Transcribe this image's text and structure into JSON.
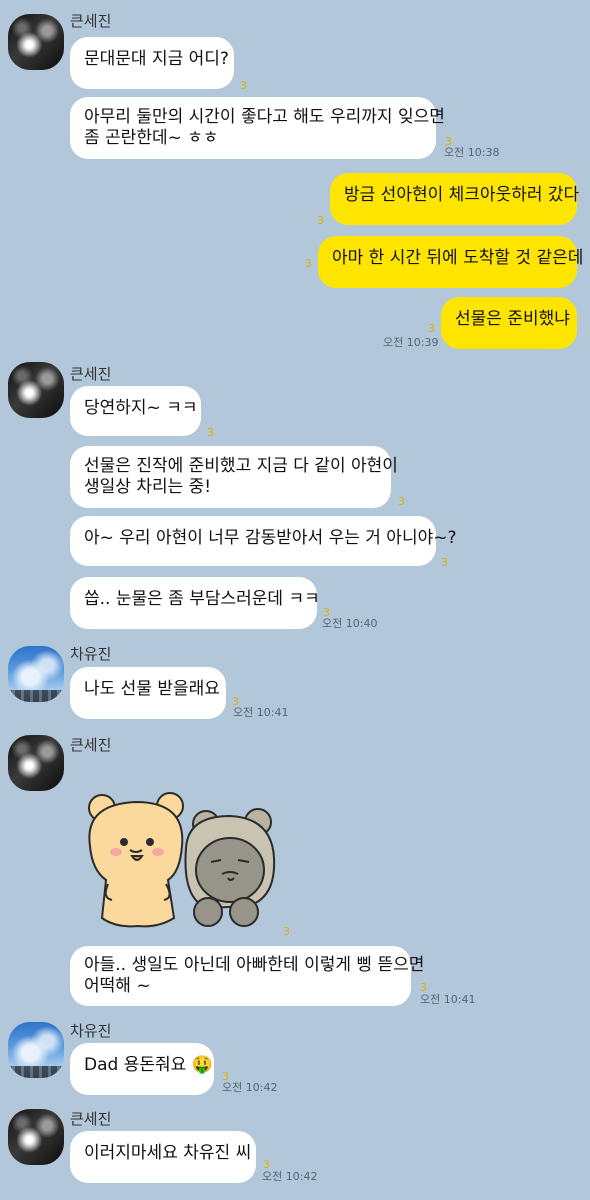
{
  "senders": {
    "seijin": "큰세진",
    "yujin": "차유진"
  },
  "messages": [
    {
      "text": "문대문대 지금 어디?",
      "unread": "3"
    },
    {
      "line1": "아무리 둘만의 시간이 좋다고 해도 우리까지 잊으면",
      "line2": "좀 곤란한데~ ㅎㅎ",
      "unread": "3",
      "time": "오전 10:38"
    },
    {
      "text": "방금 선아현이 체크아웃하러 갔다",
      "unread": "3"
    },
    {
      "text": "아마 한 시간 뒤에 도착할 것 같은데",
      "unread": "3"
    },
    {
      "text": "선물은 준비했냐",
      "unread": "3",
      "time": "오전 10:39"
    },
    {
      "text": "당연하지~ ㅋㅋ",
      "unread": "3"
    },
    {
      "line1": "선물은 진작에 준비했고 지금 다 같이 아현이",
      "line2": "생일상 차리는 중!",
      "unread": "3"
    },
    {
      "text": "아~ 우리 아현이 너무 감동받아서 우는 거 아니야~?",
      "unread": "3"
    },
    {
      "text": "씁.. 눈물은 좀 부담스러운데 ㅋㅋ",
      "unread": "3",
      "time": "오전 10:40"
    },
    {
      "text": "나도 선물 받을래요",
      "unread": "3",
      "time": "오전 10:41"
    },
    {
      "unread": "3"
    },
    {
      "line1": "아들.. 생일도 아닌데 아빠한테 이렇게 삥 뜯으면",
      "line2": "어떡해 ~",
      "unread": "3",
      "time": "오전 10:41"
    },
    {
      "text": "Dad 용돈줘요 🤑",
      "unread": "3",
      "time": "오전 10:42"
    },
    {
      "text": "이러지마세요 차유진 씨",
      "unread": "3",
      "time": "오전 10:42"
    }
  ],
  "icons": {
    "sticker": "bear-couple-sticker-icon",
    "emoji": "money-mouth-emoji"
  },
  "colors": {
    "background": "#b2c7d9",
    "my_bubble": "#fee500",
    "their_bubble": "#ffffff",
    "unread": "#d9b300"
  }
}
